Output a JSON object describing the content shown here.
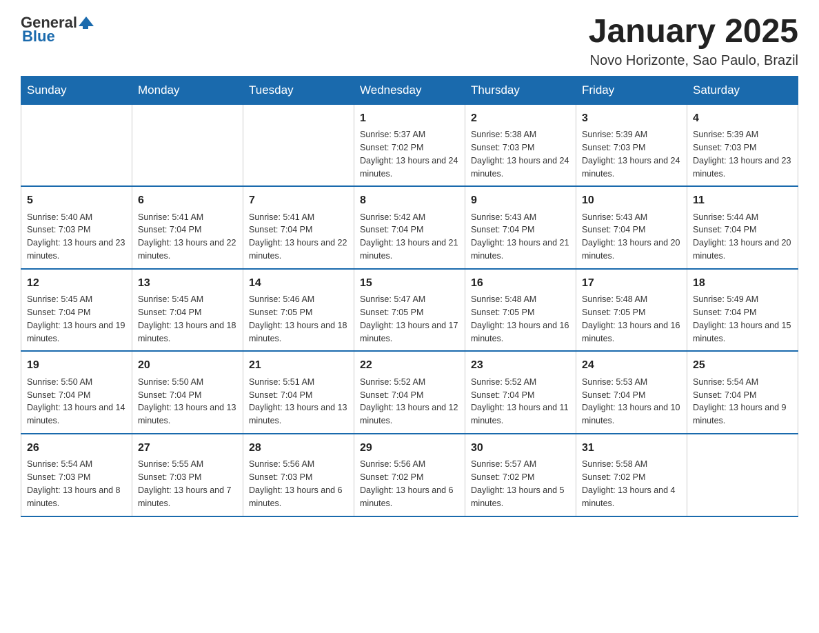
{
  "header": {
    "logo_general": "General",
    "logo_blue": "Blue",
    "month_title": "January 2025",
    "location": "Novo Horizonte, Sao Paulo, Brazil"
  },
  "days_of_week": [
    "Sunday",
    "Monday",
    "Tuesday",
    "Wednesday",
    "Thursday",
    "Friday",
    "Saturday"
  ],
  "weeks": [
    [
      {
        "day": "",
        "info": ""
      },
      {
        "day": "",
        "info": ""
      },
      {
        "day": "",
        "info": ""
      },
      {
        "day": "1",
        "info": "Sunrise: 5:37 AM\nSunset: 7:02 PM\nDaylight: 13 hours and 24 minutes."
      },
      {
        "day": "2",
        "info": "Sunrise: 5:38 AM\nSunset: 7:03 PM\nDaylight: 13 hours and 24 minutes."
      },
      {
        "day": "3",
        "info": "Sunrise: 5:39 AM\nSunset: 7:03 PM\nDaylight: 13 hours and 24 minutes."
      },
      {
        "day": "4",
        "info": "Sunrise: 5:39 AM\nSunset: 7:03 PM\nDaylight: 13 hours and 23 minutes."
      }
    ],
    [
      {
        "day": "5",
        "info": "Sunrise: 5:40 AM\nSunset: 7:03 PM\nDaylight: 13 hours and 23 minutes."
      },
      {
        "day": "6",
        "info": "Sunrise: 5:41 AM\nSunset: 7:04 PM\nDaylight: 13 hours and 22 minutes."
      },
      {
        "day": "7",
        "info": "Sunrise: 5:41 AM\nSunset: 7:04 PM\nDaylight: 13 hours and 22 minutes."
      },
      {
        "day": "8",
        "info": "Sunrise: 5:42 AM\nSunset: 7:04 PM\nDaylight: 13 hours and 21 minutes."
      },
      {
        "day": "9",
        "info": "Sunrise: 5:43 AM\nSunset: 7:04 PM\nDaylight: 13 hours and 21 minutes."
      },
      {
        "day": "10",
        "info": "Sunrise: 5:43 AM\nSunset: 7:04 PM\nDaylight: 13 hours and 20 minutes."
      },
      {
        "day": "11",
        "info": "Sunrise: 5:44 AM\nSunset: 7:04 PM\nDaylight: 13 hours and 20 minutes."
      }
    ],
    [
      {
        "day": "12",
        "info": "Sunrise: 5:45 AM\nSunset: 7:04 PM\nDaylight: 13 hours and 19 minutes."
      },
      {
        "day": "13",
        "info": "Sunrise: 5:45 AM\nSunset: 7:04 PM\nDaylight: 13 hours and 18 minutes."
      },
      {
        "day": "14",
        "info": "Sunrise: 5:46 AM\nSunset: 7:05 PM\nDaylight: 13 hours and 18 minutes."
      },
      {
        "day": "15",
        "info": "Sunrise: 5:47 AM\nSunset: 7:05 PM\nDaylight: 13 hours and 17 minutes."
      },
      {
        "day": "16",
        "info": "Sunrise: 5:48 AM\nSunset: 7:05 PM\nDaylight: 13 hours and 16 minutes."
      },
      {
        "day": "17",
        "info": "Sunrise: 5:48 AM\nSunset: 7:05 PM\nDaylight: 13 hours and 16 minutes."
      },
      {
        "day": "18",
        "info": "Sunrise: 5:49 AM\nSunset: 7:04 PM\nDaylight: 13 hours and 15 minutes."
      }
    ],
    [
      {
        "day": "19",
        "info": "Sunrise: 5:50 AM\nSunset: 7:04 PM\nDaylight: 13 hours and 14 minutes."
      },
      {
        "day": "20",
        "info": "Sunrise: 5:50 AM\nSunset: 7:04 PM\nDaylight: 13 hours and 13 minutes."
      },
      {
        "day": "21",
        "info": "Sunrise: 5:51 AM\nSunset: 7:04 PM\nDaylight: 13 hours and 13 minutes."
      },
      {
        "day": "22",
        "info": "Sunrise: 5:52 AM\nSunset: 7:04 PM\nDaylight: 13 hours and 12 minutes."
      },
      {
        "day": "23",
        "info": "Sunrise: 5:52 AM\nSunset: 7:04 PM\nDaylight: 13 hours and 11 minutes."
      },
      {
        "day": "24",
        "info": "Sunrise: 5:53 AM\nSunset: 7:04 PM\nDaylight: 13 hours and 10 minutes."
      },
      {
        "day": "25",
        "info": "Sunrise: 5:54 AM\nSunset: 7:04 PM\nDaylight: 13 hours and 9 minutes."
      }
    ],
    [
      {
        "day": "26",
        "info": "Sunrise: 5:54 AM\nSunset: 7:03 PM\nDaylight: 13 hours and 8 minutes."
      },
      {
        "day": "27",
        "info": "Sunrise: 5:55 AM\nSunset: 7:03 PM\nDaylight: 13 hours and 7 minutes."
      },
      {
        "day": "28",
        "info": "Sunrise: 5:56 AM\nSunset: 7:03 PM\nDaylight: 13 hours and 6 minutes."
      },
      {
        "day": "29",
        "info": "Sunrise: 5:56 AM\nSunset: 7:02 PM\nDaylight: 13 hours and 6 minutes."
      },
      {
        "day": "30",
        "info": "Sunrise: 5:57 AM\nSunset: 7:02 PM\nDaylight: 13 hours and 5 minutes."
      },
      {
        "day": "31",
        "info": "Sunrise: 5:58 AM\nSunset: 7:02 PM\nDaylight: 13 hours and 4 minutes."
      },
      {
        "day": "",
        "info": ""
      }
    ]
  ]
}
